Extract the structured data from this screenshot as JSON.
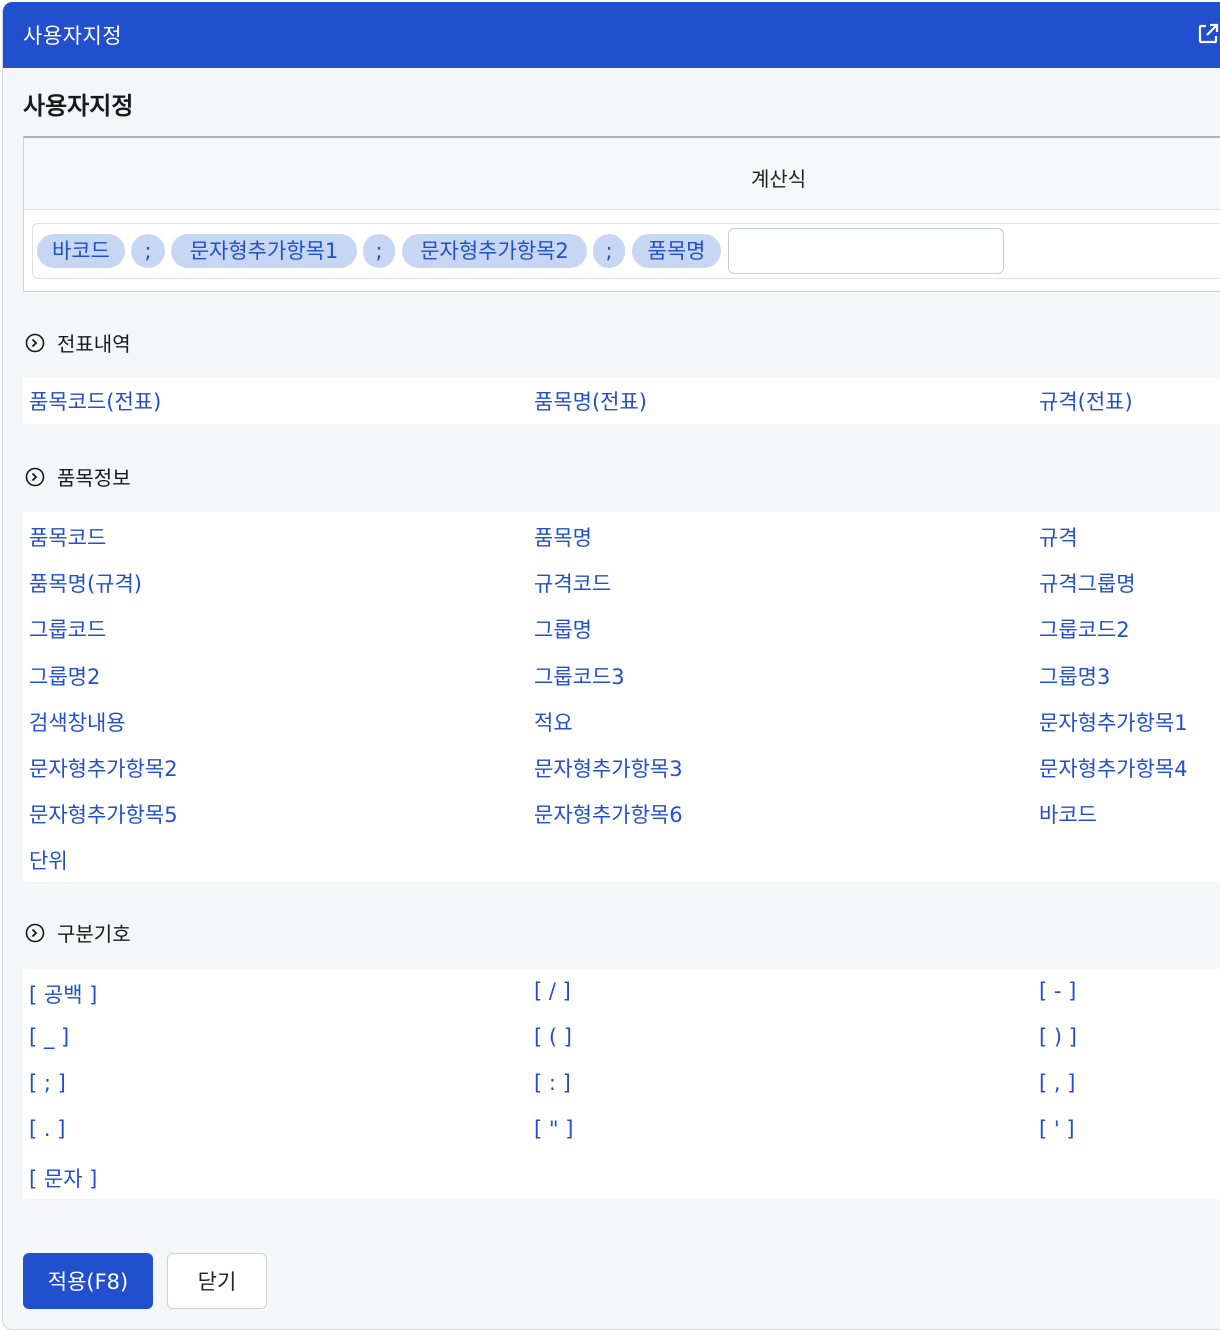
{
  "window": {
    "title": "사용자지정",
    "popout_icon": "external-link-icon"
  },
  "page_title": "사용자지정",
  "formula": {
    "header": "계산식",
    "chips": [
      "바코드",
      ";",
      "문자형추가항목1",
      ";",
      "문자형추가항목2",
      ";",
      "품목명"
    ],
    "input_value": ""
  },
  "sections": {
    "voucher": {
      "title": "전표내역",
      "icon": "chevron-circle-right-icon",
      "items": [
        "품목코드(전표)",
        "품목명(전표)",
        "규격(전표)"
      ]
    },
    "item_info": {
      "title": "품목정보",
      "icon": "chevron-circle-right-icon",
      "items": [
        "품목코드",
        "품목명",
        "규격",
        "품목명(규격)",
        "규격코드",
        "규격그룹명",
        "그룹코드",
        "그룹명",
        "그룹코드2",
        "그룹명2",
        "그룹코드3",
        "그룹명3",
        "검색창내용",
        "적요",
        "문자형추가항목1",
        "문자형추가항목2",
        "문자형추가항목3",
        "문자형추가항목4",
        "문자형추가항목5",
        "문자형추가항목6",
        "바코드",
        "단위"
      ]
    },
    "separators": {
      "title": "구분기호",
      "icon": "chevron-circle-right-icon",
      "items": [
        "[ 공백 ]",
        "[ / ]",
        "[ - ]",
        "[ _ ]",
        "[ ( ]",
        "[ ) ]",
        "[ ; ]",
        "[ : ]",
        "[ , ]",
        "[ . ]",
        "[ \" ]",
        "[ ' ]",
        "[ 문자 ]"
      ]
    }
  },
  "buttons": {
    "apply": "적용(F8)",
    "close": "닫기"
  },
  "colors": {
    "primary": "#214fce",
    "chip_bg": "#c7d7f3",
    "panel_bg": "#f5f6f8"
  }
}
